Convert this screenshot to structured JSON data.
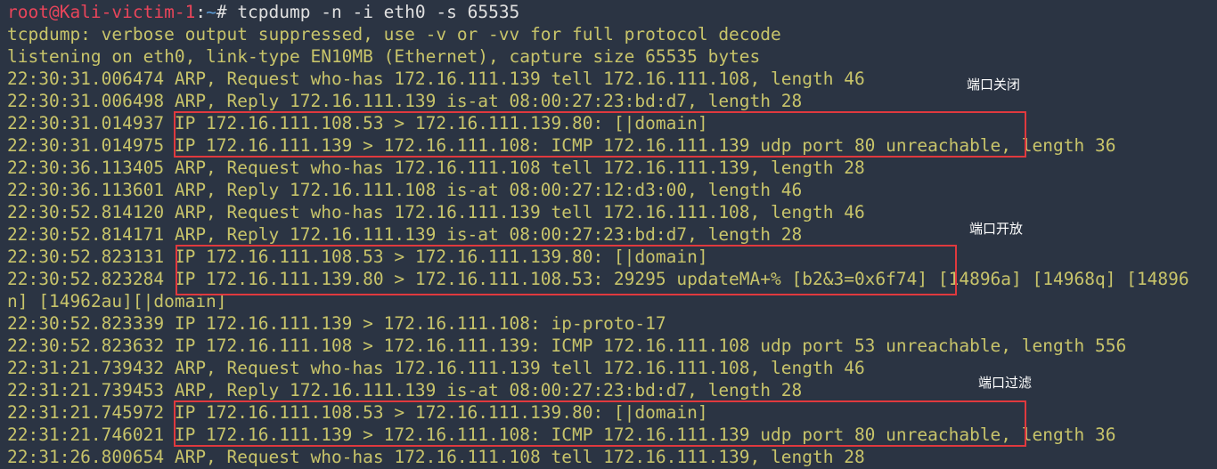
{
  "colors": {
    "background": "#2b3443",
    "terminal_text": "#c8c46a",
    "prompt_user": "#e8455a",
    "prompt_path": "#5b9bd5",
    "highlight_box": "#e0393e",
    "annotation_text": "#ffffff"
  },
  "prompt": {
    "user_host": "root@Kali-victim-1",
    "colon": ":",
    "path": "~",
    "symbol": "#",
    "command": " tcpdump -n -i eth0 -s 65535"
  },
  "output_lines": [
    "tcpdump: verbose output suppressed, use -v or -vv for full protocol decode",
    "listening on eth0, link-type EN10MB (Ethernet), capture size 65535 bytes",
    "22:30:31.006474 ARP, Request who-has 172.16.111.139 tell 172.16.111.108, length 46",
    "22:30:31.006498 ARP, Reply 172.16.111.139 is-at 08:00:27:23:bd:d7, length 28",
    "22:30:31.014937 IP 172.16.111.108.53 > 172.16.111.139.80: [|domain]",
    "22:30:31.014975 IP 172.16.111.139 > 172.16.111.108: ICMP 172.16.111.139 udp port 80 unreachable, length 36",
    "22:30:36.113405 ARP, Request who-has 172.16.111.108 tell 172.16.111.139, length 28",
    "22:30:36.113601 ARP, Reply 172.16.111.108 is-at 08:00:27:12:d3:00, length 46",
    "22:30:52.814120 ARP, Request who-has 172.16.111.139 tell 172.16.111.108, length 46",
    "22:30:52.814171 ARP, Reply 172.16.111.139 is-at 08:00:27:23:bd:d7, length 28",
    "22:30:52.823131 IP 172.16.111.108.53 > 172.16.111.139.80: [|domain]",
    "22:30:52.823284 IP 172.16.111.139.80 > 172.16.111.108.53: 29295 updateMA+% [b2&3=0x6f74] [14896a] [14968q] [14896",
    "n] [14962au][|domain]",
    "22:30:52.823339 IP 172.16.111.139 > 172.16.111.108: ip-proto-17",
    "22:30:52.823632 IP 172.16.111.108 > 172.16.111.139: ICMP 172.16.111.108 udp port 53 unreachable, length 556",
    "22:31:21.739432 ARP, Request who-has 172.16.111.139 tell 172.16.111.108, length 46",
    "22:31:21.739453 ARP, Reply 172.16.111.139 is-at 08:00:27:23:bd:d7, length 28",
    "22:31:21.745972 IP 172.16.111.108.53 > 172.16.111.139.80: [|domain]",
    "22:31:21.746021 IP 172.16.111.139 > 172.16.111.108: ICMP 172.16.111.139 udp port 80 unreachable, length 36",
    "22:31:26.800654 ARP, Request who-has 172.16.111.108 tell 172.16.111.139, length 28"
  ],
  "annotations": {
    "port_closed": "端口关闭",
    "port_open": "端口开放",
    "port_filtered": "端口过滤"
  }
}
